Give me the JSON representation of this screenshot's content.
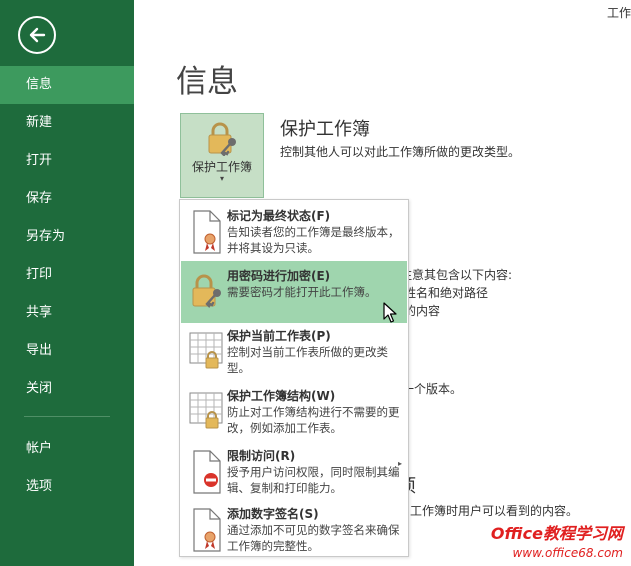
{
  "window": {
    "title_fragment": "工作"
  },
  "sidebar": {
    "items": [
      {
        "label": "信息",
        "active": true
      },
      {
        "label": "新建"
      },
      {
        "label": "打开"
      },
      {
        "label": "保存"
      },
      {
        "label": "另存为"
      },
      {
        "label": "打印"
      },
      {
        "label": "共享"
      },
      {
        "label": "导出"
      },
      {
        "label": "关闭"
      }
    ],
    "bottom_items": [
      {
        "label": "帐户"
      },
      {
        "label": "选项"
      }
    ]
  },
  "main": {
    "title": "信息",
    "protect": {
      "button_label": "保护工作簿",
      "caret": "▾",
      "heading": "保护工作簿",
      "description": "控制其他人可以对此工作簿所做的更改类型。"
    },
    "background_lines": [
      "注意其包含以下内容:",
      "姓名和绝对路径",
      "的内容",
      "一个版本。",
      "项",
      "工作簿时用户可以看到的内容。"
    ]
  },
  "menu": {
    "items": [
      {
        "title": "标记为最终状态(F)",
        "desc": "告知读者您的工作簿是最终版本，并将其设为只读。",
        "icon": "final-document-icon"
      },
      {
        "title": "用密码进行加密(E)",
        "desc": "需要密码才能打开此工作簿。",
        "icon": "lock-key-icon",
        "highlighted": true
      },
      {
        "title": "保护当前工作表(P)",
        "desc": "控制对当前工作表所做的更改类型。",
        "icon": "sheet-lock-icon"
      },
      {
        "title": "保护工作簿结构(W)",
        "desc": "防止对工作簿结构进行不需要的更改，例如添加工作表。",
        "icon": "workbook-lock-icon"
      },
      {
        "title": "限制访问(R)",
        "desc": "授予用户访问权限，同时限制其编辑、复制和打印能力。",
        "icon": "restrict-access-icon",
        "has_submenu": true,
        "arrow": "▸"
      },
      {
        "title": "添加数字签名(S)",
        "desc": "通过添加不可见的数字签名来确保工作簿的完整性。",
        "icon": "digital-signature-icon"
      }
    ]
  },
  "watermark": {
    "text": "Office教程学习网",
    "url": "www.office68.com"
  },
  "colors": {
    "sidebar": "#1e6b3c",
    "sidebar_active": "#3d9a5e",
    "menu_highlight": "#9fd5ae",
    "protect_button": "#c6dfc6"
  }
}
